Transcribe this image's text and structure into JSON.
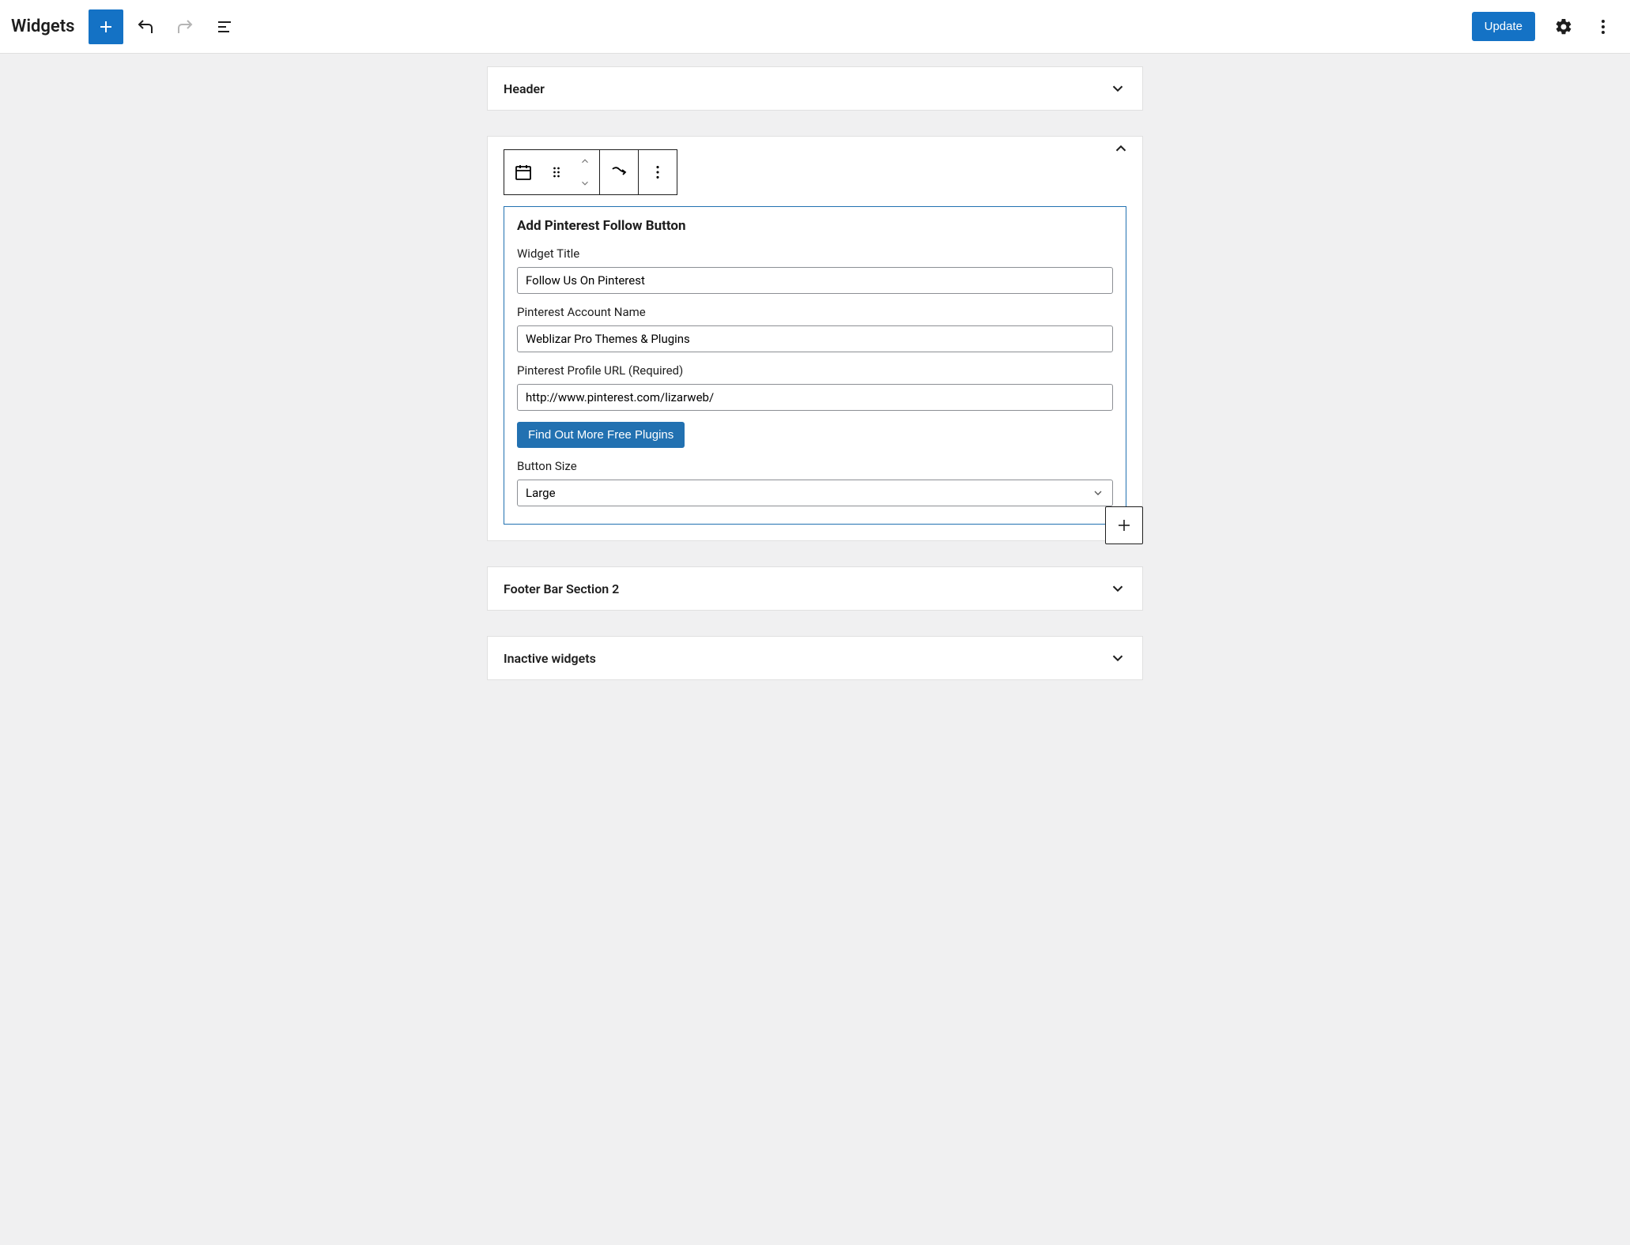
{
  "header": {
    "page_title": "Widgets",
    "update_label": "Update"
  },
  "areas": {
    "header_area_title": "Header",
    "footer_area_title": "Footer Bar Section 2",
    "inactive_area_title": "Inactive widgets"
  },
  "widget": {
    "form_title": "Add Pinterest Follow Button",
    "title_label": "Widget Title",
    "title_value": "Follow Us On Pinterest",
    "account_label": "Pinterest Account Name",
    "account_value": "Weblizar Pro Themes & Plugins",
    "profile_url_label": "Pinterest Profile URL (Required)",
    "profile_url_value": "http://www.pinterest.com/lizarweb/",
    "cta_label": "Find Out More Free Plugins",
    "size_label": "Button Size",
    "size_value": "Large"
  }
}
